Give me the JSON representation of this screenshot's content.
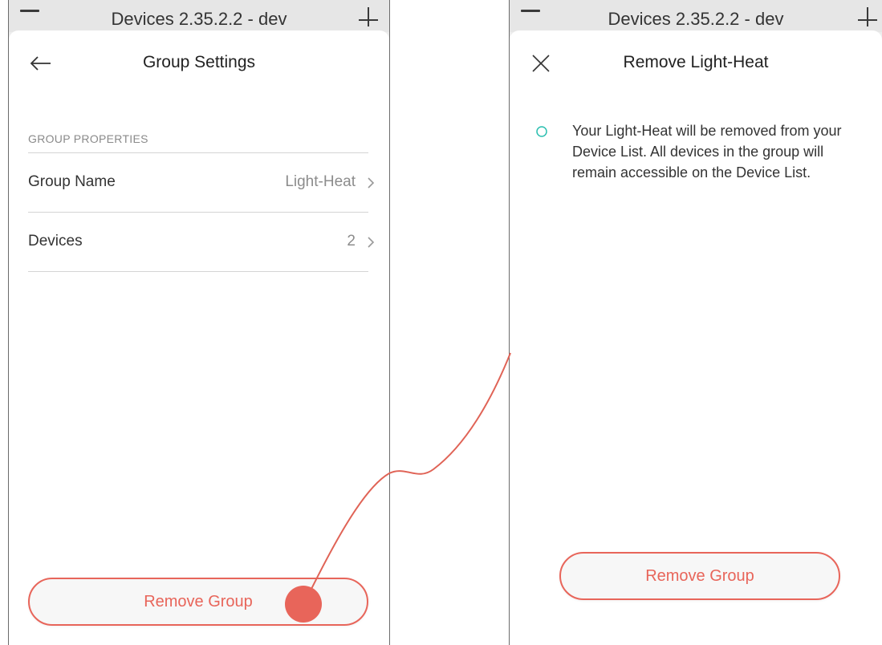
{
  "left_screen": {
    "background_title": "Devices 2.35.2.2 - dev",
    "nav_title": "Group Settings",
    "section_label": "GROUP PROPERTIES",
    "rows": [
      {
        "label": "Group Name",
        "value": "Light-Heat"
      },
      {
        "label": "Devices",
        "value": "2"
      }
    ],
    "remove_button": "Remove Group"
  },
  "right_screen": {
    "background_title": "Devices 2.35.2.2 - dev",
    "nav_title": "Remove Light-Heat",
    "notice": "Your Light-Heat will be removed from your Device List. All devices in the group will remain accessible on the Device List.",
    "remove_button": "Remove Group"
  },
  "colors": {
    "accent": "#e8655a",
    "notice_icon": "#2bbfb0",
    "divider": "#d4d4d4"
  },
  "icons": {
    "back": "arrow-left-icon",
    "close": "close-icon",
    "chevron": "chevron-right-icon",
    "notice": "circle-outline-icon",
    "menu": "hamburger-icon",
    "add": "plus-icon"
  }
}
